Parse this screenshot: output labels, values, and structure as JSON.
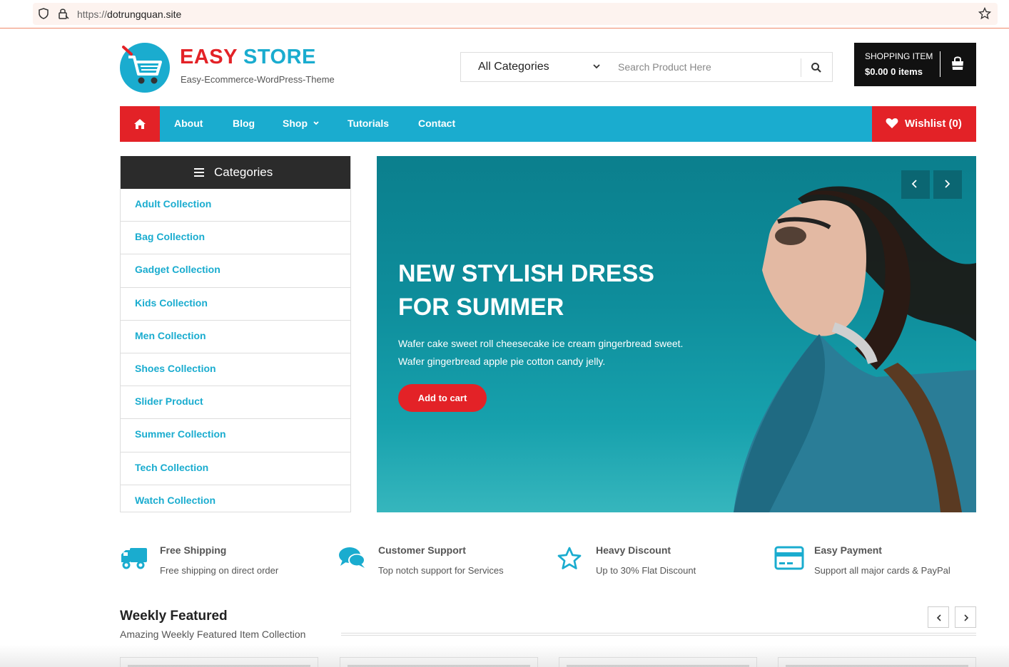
{
  "browser": {
    "url_protocol": "https://",
    "url_host": "dotrungquan.site"
  },
  "header": {
    "logo_word1": "EASY",
    "logo_word2": "STORE",
    "tagline": "Easy-Ecommerce-WordPress-Theme",
    "category_select": "All Categories",
    "search_placeholder": "Search Product Here",
    "cart_title": "SHOPPING ITEM",
    "cart_amount": "$0.00 0 items"
  },
  "nav": {
    "items": [
      "About",
      "Blog",
      "Shop",
      "Tutorials",
      "Contact"
    ],
    "wishlist": "Wishlist  (0)"
  },
  "categories": {
    "title": "Categories",
    "items": [
      "Adult Collection",
      "Bag Collection",
      "Gadget Collection",
      "Kids Collection",
      "Men Collection",
      "Shoes Collection",
      "Slider Product",
      "Summer Collection",
      "Tech Collection",
      "Watch Collection"
    ]
  },
  "hero": {
    "title": "NEW STYLISH DRESS FOR SUMMER",
    "text": "Wafer cake sweet roll cheesecake ice cream gingerbread sweet. Wafer gingerbread apple pie cotton candy jelly.",
    "button": "Add to cart"
  },
  "features": [
    {
      "title": "Free Shipping",
      "text": "Free shipping on direct order",
      "icon": "truck-icon"
    },
    {
      "title": "Customer Support",
      "text": "Top notch support for Services",
      "icon": "chat-icon"
    },
    {
      "title": "Heavy Discount",
      "text": "Up to 30% Flat Discount",
      "icon": "star-icon"
    },
    {
      "title": "Easy Payment",
      "text": "Support all major cards & PayPal",
      "icon": "credit-card-icon"
    }
  ],
  "weekly": {
    "title": "Weekly Featured",
    "subtitle": "Amazing Weekly Featured Item Collection"
  },
  "colors": {
    "brand_red": "#e32227",
    "brand_blue": "#1aaccf",
    "dark": "#2b2b2b"
  }
}
